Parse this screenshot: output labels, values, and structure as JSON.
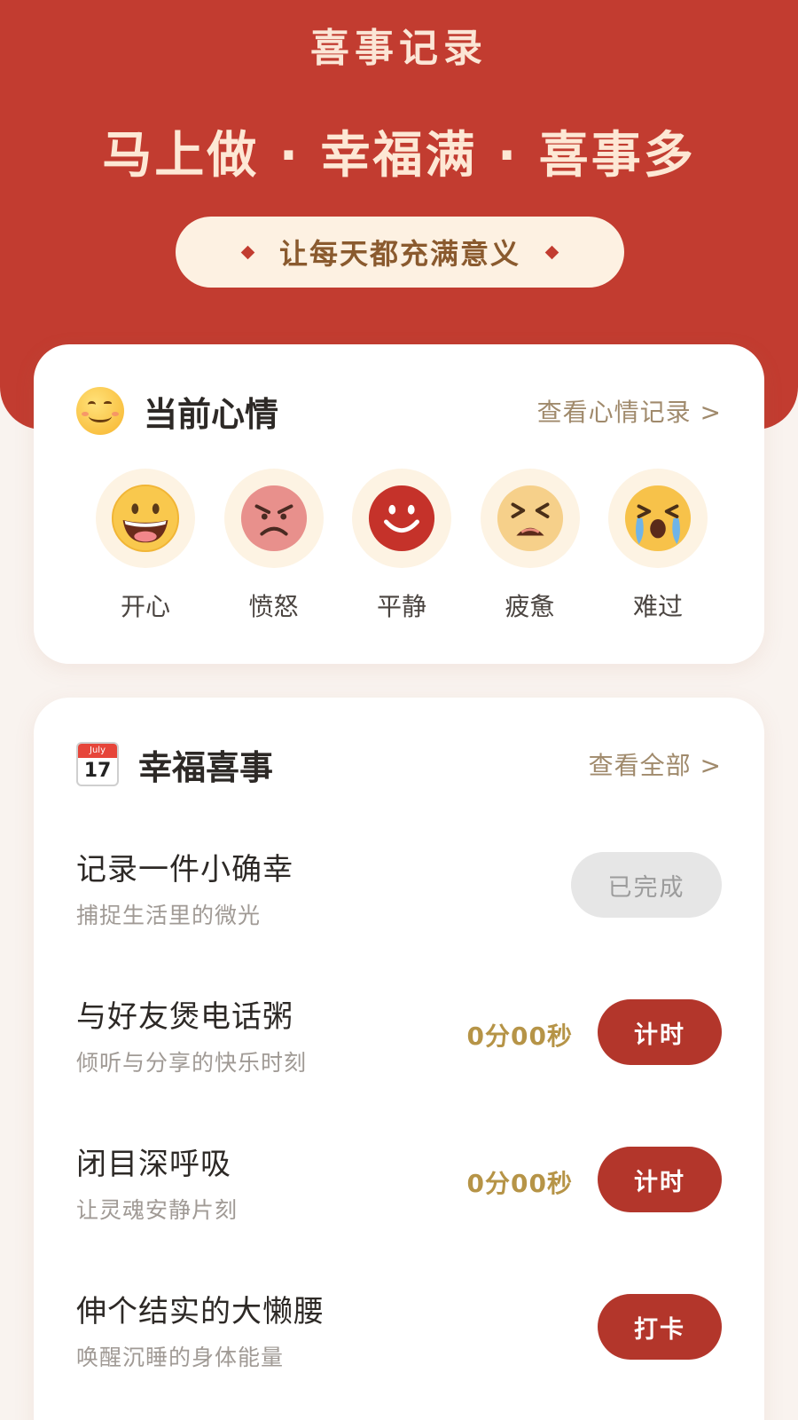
{
  "header": {
    "title": "喜事记录",
    "slogan": "马上做 · 幸福满 · 喜事多",
    "tagline": "让每天都充满意义",
    "bg_color": "#c23c30"
  },
  "mood_card": {
    "title": "当前心情",
    "link": "查看心情记录 >",
    "icon": "smiling-face-icon",
    "moods": [
      {
        "label": "开心",
        "icon": "happy-face-icon"
      },
      {
        "label": "愤怒",
        "icon": "angry-face-icon"
      },
      {
        "label": "平静",
        "icon": "calm-face-icon"
      },
      {
        "label": "疲惫",
        "icon": "tired-face-icon"
      },
      {
        "label": "难过",
        "icon": "crying-face-icon"
      }
    ]
  },
  "events_card": {
    "title": "幸福喜事",
    "link": "查看全部 >",
    "icon": "calendar-icon",
    "calendar_month": "July",
    "calendar_day": "17",
    "tasks": [
      {
        "title": "记录一件小确幸",
        "subtitle": "捕捉生活里的微光",
        "timer": "",
        "button": "已完成",
        "state": "done"
      },
      {
        "title": "与好友煲电话粥",
        "subtitle": "倾听与分享的快乐时刻",
        "timer": "0分00秒",
        "button": "计时",
        "state": "active"
      },
      {
        "title": "闭目深呼吸",
        "subtitle": "让灵魂安静片刻",
        "timer": "0分00秒",
        "button": "计时",
        "state": "active"
      },
      {
        "title": "伸个结实的大懒腰",
        "subtitle": "唤醒沉睡的身体能量",
        "timer": "",
        "button": "打卡",
        "state": "active"
      }
    ]
  }
}
